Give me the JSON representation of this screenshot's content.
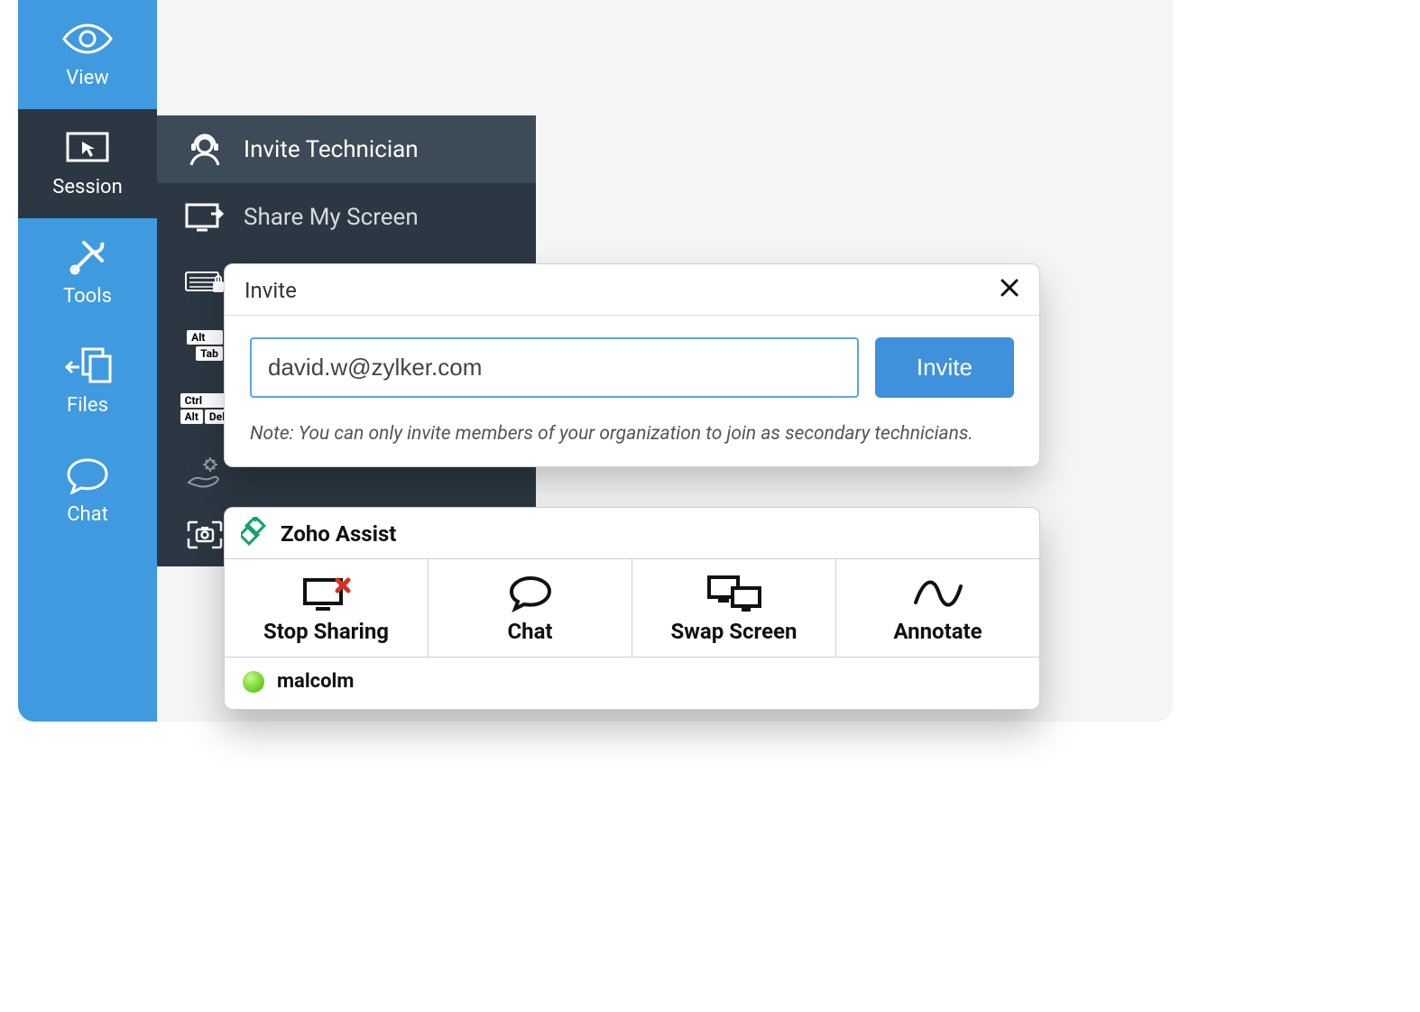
{
  "sidebar": {
    "items": [
      {
        "label": "View"
      },
      {
        "label": "Session"
      },
      {
        "label": "Tools"
      },
      {
        "label": "Files"
      },
      {
        "label": "Chat"
      }
    ]
  },
  "session_menu": {
    "invite_technician": "Invite Technician",
    "share_my_screen": "Share My Screen"
  },
  "invite_dialog": {
    "title": "Invite",
    "email_value": "david.w@zylker.com",
    "button_label": "Invite",
    "note": "Note: You can only invite members of your organization to join as secondary technicians."
  },
  "assist_panel": {
    "title": "Zoho Assist",
    "actions": [
      {
        "label": "Stop Sharing"
      },
      {
        "label": "Chat"
      },
      {
        "label": "Swap Screen"
      },
      {
        "label": "Annotate"
      }
    ],
    "participant": "malcolm"
  },
  "colors": {
    "primary": "#3f9ae0",
    "panel_dark": "#2b3742"
  }
}
